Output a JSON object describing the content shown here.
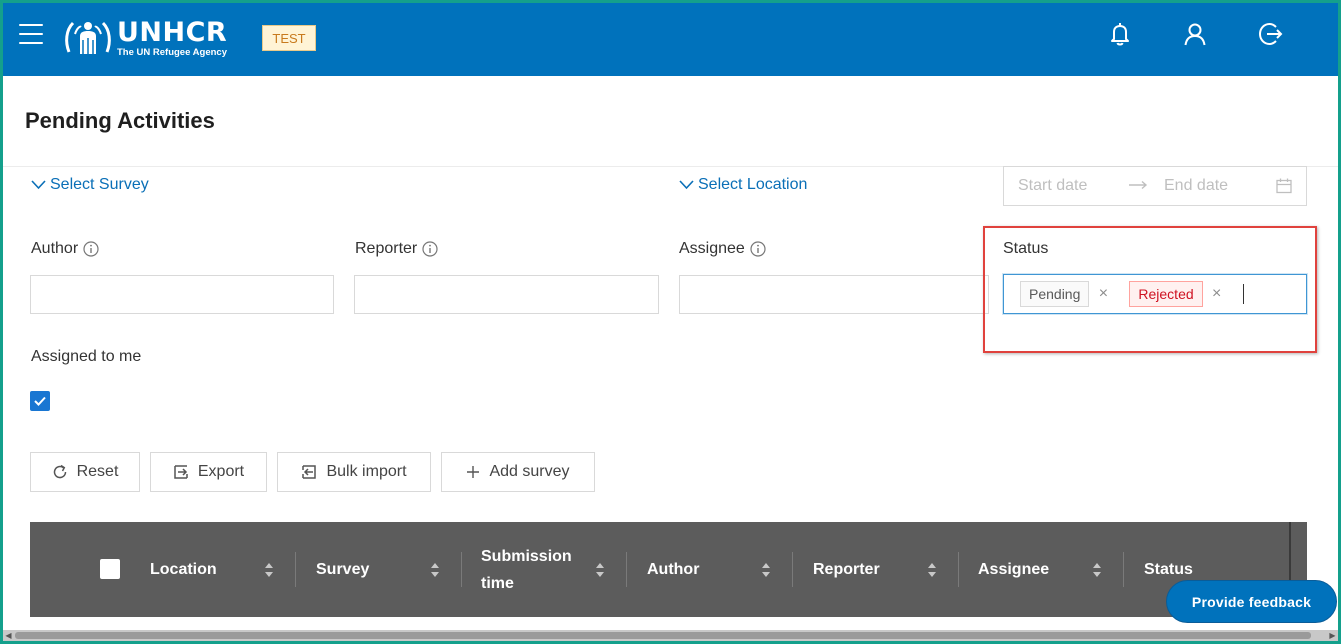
{
  "header": {
    "logo_title": "UNHCR",
    "logo_subtitle": "The UN Refugee Agency",
    "env_badge": "TEST",
    "icons": [
      "menu-icon",
      "bell-icon",
      "user-icon",
      "logout-icon"
    ],
    "bg_color": "#0072bc"
  },
  "page": {
    "title": "Pending Activities"
  },
  "filters": {
    "select_survey": "Select Survey",
    "select_location": "Select Location",
    "date_start_placeholder": "Start date",
    "date_end_placeholder": "End date",
    "author_label": "Author",
    "reporter_label": "Reporter",
    "assignee_label": "Assignee",
    "status_label": "Status",
    "status_tags": [
      "Pending",
      "Rejected"
    ],
    "assigned_to_me_label": "Assigned to me",
    "assigned_to_me_checked": true
  },
  "actions": {
    "reset": "Reset",
    "export": "Export",
    "bulk_import": "Bulk import",
    "add_survey": "Add survey"
  },
  "table": {
    "columns": [
      "Location",
      "Survey",
      "Submission time",
      "Author",
      "Reporter",
      "Assignee",
      "Status"
    ]
  },
  "feedback_button": "Provide feedback",
  "colors": {
    "accent": "#0072bc",
    "link": "#0a6fb7",
    "rejected": "#cf1322",
    "highlight": "#e0423d",
    "table_header": "#5c5c5c"
  }
}
